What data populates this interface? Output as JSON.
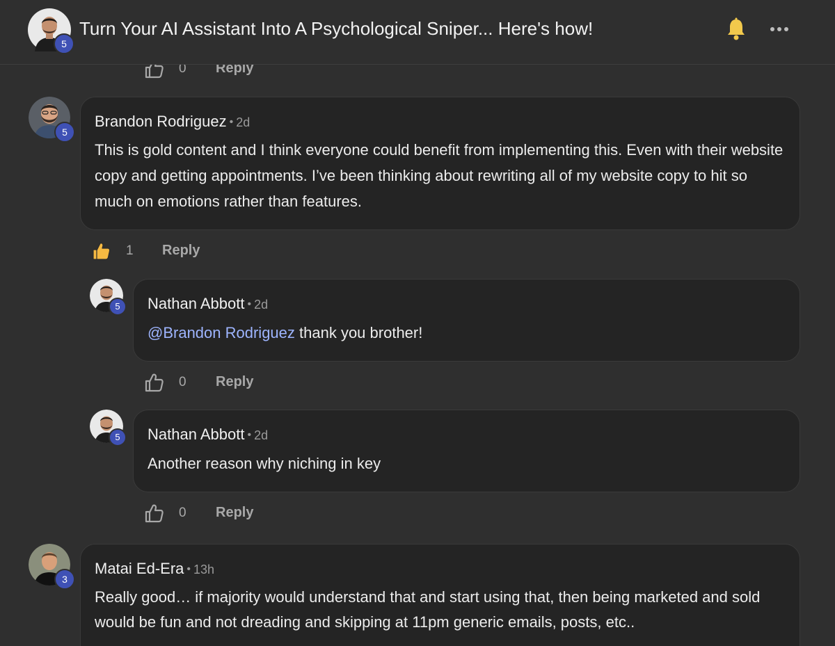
{
  "post": {
    "title": "Turn Your AI Assistant Into A Psychological Sniper... Here's how!",
    "author_level": "5"
  },
  "partial_action": {
    "likes": "0",
    "reply_label": "Reply"
  },
  "comments": [
    {
      "author": "Brandon Rodriguez",
      "time": "2d",
      "level": "5",
      "body": "This is gold content and I think everyone could benefit from implementing this. Even with their website copy and getting appointments. I’ve been thinking about rewriting all of my website copy to hit so much on emotions rather than features.",
      "likes": "1",
      "liked": true,
      "reply_label": "Reply"
    },
    {
      "author": "Nathan Abbott",
      "time": "2d",
      "level": "5",
      "mention": "@Brandon Rodriguez",
      "body": " thank you brother!",
      "likes": "0",
      "liked": false,
      "reply_label": "Reply"
    },
    {
      "author": "Nathan Abbott",
      "time": "2d",
      "level": "5",
      "body": "Another reason why niching in key",
      "likes": "0",
      "liked": false,
      "reply_label": "Reply"
    },
    {
      "author": "Matai Ed-Era",
      "time": "13h",
      "level": "3",
      "body": "Really good… if majority would understand that and start using that, then being marketed and sold would be fun and not dreading and skipping at 11pm generic emails, posts, etc.."
    }
  ],
  "colors": {
    "background": "#2f2f2f",
    "bubble": "#242424",
    "badge": "#3f51b5",
    "mention": "#9eb5ff",
    "bell": "#f2c94c",
    "liked": "#f5b942"
  },
  "icons": {
    "bell": "bell-icon",
    "more": "more-options-icon",
    "like": "thumbs-up-icon"
  }
}
